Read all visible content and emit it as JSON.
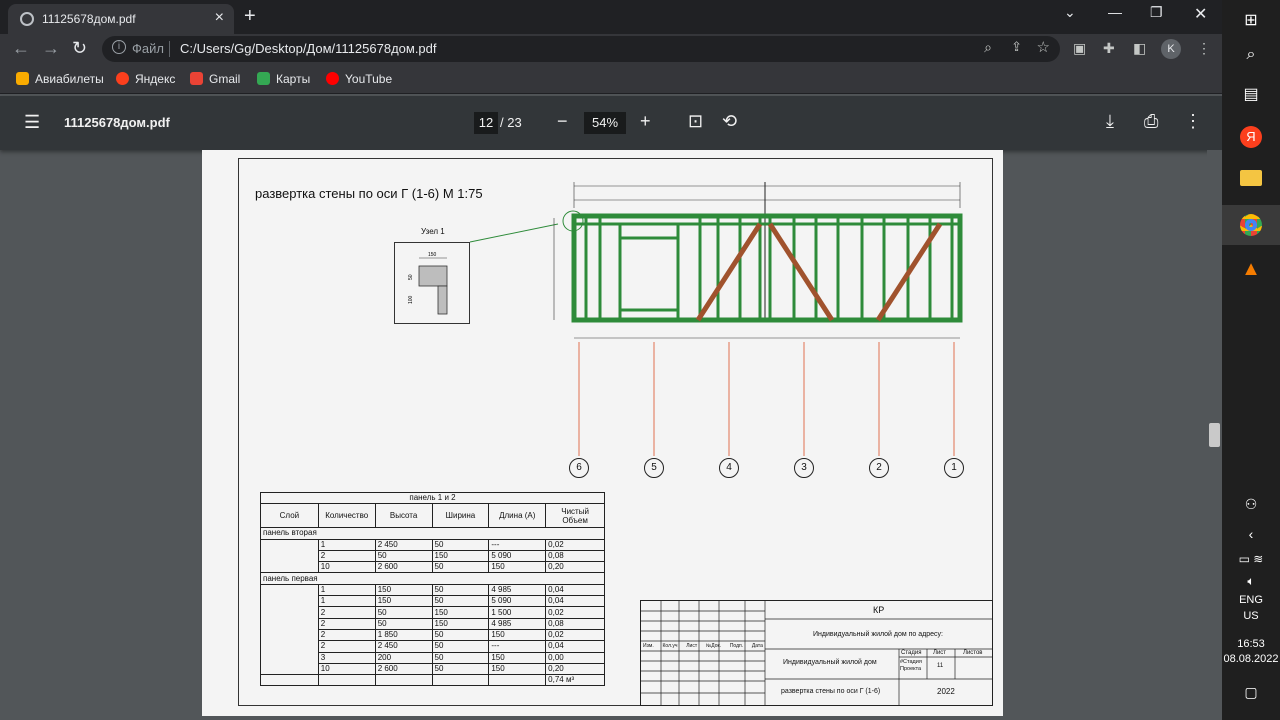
{
  "browser": {
    "tab_title": "11125678дом.pdf",
    "scheme_label": "Файл",
    "url": "C:/Users/Gg/Desktop/Дом/11125678дом.pdf",
    "avatar_letter": "K",
    "bookmarks": [
      {
        "label": "Авиабилеты",
        "color": "#f9ab00"
      },
      {
        "label": "Яндекс",
        "color": "#fc3f1d"
      },
      {
        "label": "Gmail",
        "color": "#ea4335"
      },
      {
        "label": "Карты",
        "color": "#34a853"
      },
      {
        "label": "YouTube",
        "color": "#ff0000"
      }
    ]
  },
  "pdf_toolbar": {
    "file_name": "11125678дом.pdf",
    "current_page": "12",
    "total_pages": "/ 23",
    "zoom": "54%"
  },
  "drawing": {
    "title": "развертка стены по оси Г (1-6)   М 1:75",
    "node_label": "Узел 1",
    "node_dims": [
      "150",
      "50",
      "100"
    ],
    "axes": [
      "6",
      "5",
      "4",
      "3",
      "2",
      "1"
    ]
  },
  "spec_table": {
    "title": "панель 1 и 2",
    "headers": [
      "Слой",
      "Количество",
      "Высота",
      "Ширина",
      "Длина (А)",
      "Чистый Объем"
    ],
    "sections": [
      {
        "name": "панель вторая",
        "rows": [
          [
            "1",
            "2 450",
            "50",
            "---",
            "0,02"
          ],
          [
            "2",
            "50",
            "150",
            "5 090",
            "0,08"
          ],
          [
            "10",
            "2 600",
            "50",
            "150",
            "0,20"
          ]
        ]
      },
      {
        "name": "панель первая",
        "rows": [
          [
            "1",
            "150",
            "50",
            "4 985",
            "0,04"
          ],
          [
            "1",
            "150",
            "50",
            "5 090",
            "0,04"
          ],
          [
            "2",
            "50",
            "150",
            "1 500",
            "0,02"
          ],
          [
            "2",
            "50",
            "150",
            "4 985",
            "0,08"
          ],
          [
            "2",
            "1 850",
            "50",
            "150",
            "0,02"
          ],
          [
            "2",
            "2 450",
            "50",
            "---",
            "0,04"
          ],
          [
            "3",
            "200",
            "50",
            "150",
            "0,00"
          ],
          [
            "10",
            "2 600",
            "50",
            "150",
            "0,20"
          ]
        ]
      }
    ],
    "total": "0,74 м³"
  },
  "stamp": {
    "code": "КР",
    "address": "Индивидуальный жилой дом по адресу:",
    "object": "Индивидуальный жилой дом",
    "sheet_title": "развертка стены по оси Г (1-6)",
    "year": "2022",
    "col_headers": [
      "Изм.",
      "Кол.уч",
      "Лист",
      "№Док.",
      "Подп.",
      "Дата"
    ],
    "stage_label": "Стадия",
    "sheet_label": "Лист",
    "sheets_label": "Листов",
    "stage_value": "#Стадия Проекта",
    "sheet_value": "11"
  },
  "taskbar": {
    "lang": "ENG",
    "region": "US",
    "time": "16:53",
    "date": "08.08.2022"
  },
  "colors": {
    "frame_green": "#2e8b3a",
    "brace_brown": "#a0522d",
    "axis_line": "#e07050"
  }
}
